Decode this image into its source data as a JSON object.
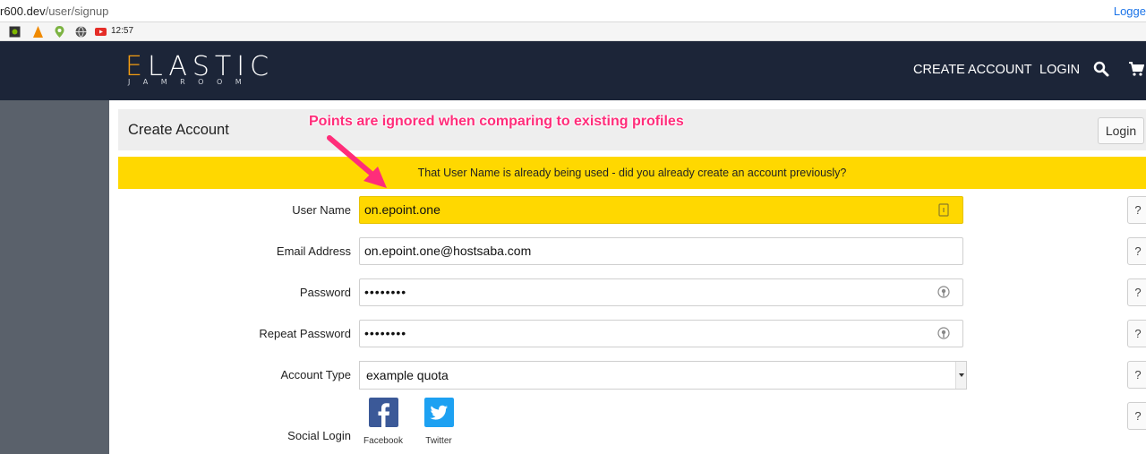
{
  "browser": {
    "url_host": "r600.dev",
    "url_path": "/user/signup",
    "logged_status": "Logge",
    "time": "12:57"
  },
  "header": {
    "logo_main": "LASTIC",
    "logo_initial": "E",
    "logo_sub": "JAMROOM",
    "nav_create": "CREATE ACCOUNT",
    "nav_login": "LOGIN",
    "search_icon": "search-icon",
    "cart_icon": "cart-icon"
  },
  "card": {
    "title": "Create Account",
    "login_button": "Login"
  },
  "annotation": "Points are ignored when comparing to existing profiles",
  "alert": "That User Name is already being used - did you already create an account previously?",
  "form": {
    "user_name": {
      "label": "User Name",
      "value": "on.epoint.one"
    },
    "email": {
      "label": "Email Address",
      "value": "on.epoint.one@hostsaba.com"
    },
    "password": {
      "label": "Password",
      "value": "••••••••"
    },
    "repeat_password": {
      "label": "Repeat Password",
      "value": "••••••••"
    },
    "account_type": {
      "label": "Account Type",
      "value": "example quota"
    },
    "social": {
      "label": "Social Login",
      "facebook": "Facebook",
      "twitter": "Twitter"
    },
    "help": "?"
  },
  "colors": {
    "header_bg": "#1c2538",
    "accent_orange": "#f39c12",
    "alert_yellow": "#ffd800",
    "annotation_pink": "#ff2d7a",
    "sidebar_gray": "#5a616b",
    "facebook_blue": "#3b5998",
    "twitter_blue": "#1da1f2"
  }
}
